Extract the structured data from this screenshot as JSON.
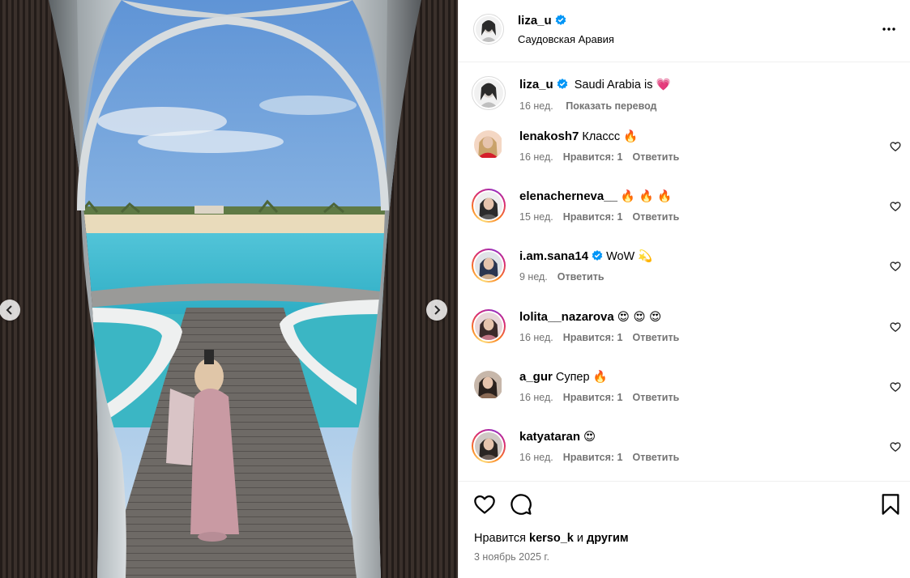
{
  "post": {
    "author": "liza_u",
    "location": "Саудовская Аравия",
    "caption_author": "liza_u",
    "caption_text": "Saudi Arabia is",
    "caption_emoji": "💗",
    "caption_time": "16 нед.",
    "translate_label": "Показать перевод"
  },
  "comments": [
    {
      "user": "lenakosh7",
      "text": "Классс",
      "emoji": "🔥",
      "time": "16 нед.",
      "likes": "Нравится: 1",
      "reply": "Ответить",
      "verified": false
    },
    {
      "user": "elenacherneva__",
      "text": "",
      "emoji": "🔥 🔥 🔥",
      "time": "15 нед.",
      "likes": "Нравится: 1",
      "reply": "Ответить",
      "verified": false
    },
    {
      "user": "i.am.sana14",
      "text": "WoW",
      "emoji": "💫",
      "time": "9 нед.",
      "likes": "",
      "reply": "Ответить",
      "verified": true
    },
    {
      "user": "lolita__nazarova",
      "text": "",
      "emoji": "😍 😍 😍",
      "time": "16 нед.",
      "likes": "Нравится: 1",
      "reply": "Ответить",
      "verified": false
    },
    {
      "user": "a_gur",
      "text": "Супер",
      "emoji": "🔥",
      "time": "16 нед.",
      "likes": "Нравится: 1",
      "reply": "Ответить",
      "verified": false
    },
    {
      "user": "katyataran",
      "text": "",
      "emoji": "😍",
      "time": "16 нед.",
      "likes": "Нравится: 1",
      "reply": "Ответить",
      "verified": false
    }
  ],
  "footer": {
    "likes_prefix": "Нравится",
    "likes_user": "kerso_k",
    "likes_and": "и",
    "likes_others": "другим",
    "date": "3 ноябрь 2025 г."
  },
  "icons": {
    "more": "more-horizontal-icon",
    "like": "heart-outline-icon",
    "comment": "comment-bubble-icon",
    "save": "bookmark-icon",
    "verified": "verified-badge-icon",
    "prev": "chevron-left-icon",
    "next": "chevron-right-icon"
  },
  "colors": {
    "verified": "#0095f6",
    "meta_text": "#737373",
    "divider": "#efefef"
  }
}
